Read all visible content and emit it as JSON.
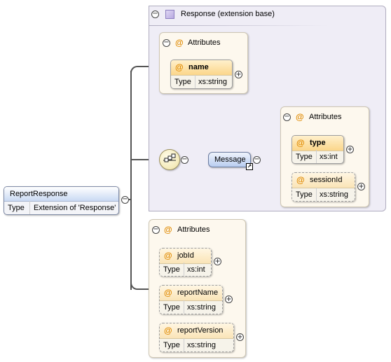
{
  "root": {
    "name": "ReportResponse",
    "type_key": "Type",
    "type_value": "Extension of 'Response'"
  },
  "extension": {
    "title": "Response (extension base)",
    "attributes": {
      "title": "Attributes",
      "items": [
        {
          "name": "name",
          "type_key": "Type",
          "type_value": "xs:string"
        }
      ]
    },
    "message": {
      "name": "Message",
      "attributes": {
        "title": "Attributes",
        "items": [
          {
            "name": "type",
            "type_key": "Type",
            "type_value": "xs:int"
          },
          {
            "name": "sessionId",
            "type_key": "Type",
            "type_value": "xs:string"
          }
        ]
      }
    }
  },
  "own_attributes": {
    "title": "Attributes",
    "items": [
      {
        "name": "jobId",
        "type_key": "Type",
        "type_value": "xs:int"
      },
      {
        "name": "reportName",
        "type_key": "Type",
        "type_value": "xs:string"
      },
      {
        "name": "reportVersion",
        "type_key": "Type",
        "type_value": "xs:string"
      }
    ]
  },
  "symbols": {
    "attribute_marker": "@",
    "collapse": "−",
    "expand": "+",
    "ref_arrow": "↗"
  },
  "colors": {
    "extension_panel": "#efedf6",
    "attribute_group": "#fdf8ee",
    "attribute_header": "#fbd68a",
    "element_header": "#c9d9f3",
    "attribute_marker": "#e08a00"
  }
}
